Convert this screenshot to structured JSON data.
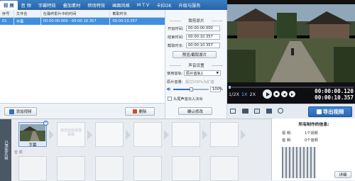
{
  "tabs": [
    "视 频",
    "音 频",
    "字幕特效",
    "叠加素材",
    "转场特效",
    "画面风格",
    "M T V",
    "卡拉OK",
    "升级与服务"
  ],
  "table": {
    "headers": [
      "序号",
      "文件名",
      "在最终影片中的时间",
      "截取时长"
    ],
    "rows": [
      {
        "num": "01",
        "name": "字幕",
        "time": "00:00:00.000 - 00:00:10.357",
        "duration": "00:00:10.357"
      }
    ]
  },
  "clipbar": {
    "add_label": "添加视频",
    "delete_label": "删除"
  },
  "settings": {
    "section_clip": "裁剪原片",
    "start_label": "开始时间:",
    "start_value": "00:00:00.000",
    "end_label": "结束时间:",
    "end_value": "00:00:10.357",
    "duration_label": "截取时长:",
    "duration_value": "00:00:10.357",
    "preview_button": "预览/截取原片",
    "section_audio": "声音设置",
    "track_label": "使用音轨:",
    "track_value": "原片音轨1",
    "volume_label": "原片音量:",
    "volume_hint": "超过100%为扩音",
    "volume_value": "100%",
    "fade_label": "头尾声音淡入淡出",
    "confirm_button": "确认修改"
  },
  "player": {
    "speed_options": [
      "1/2X",
      "1X",
      "2X"
    ],
    "current_time": "00:00:00.120",
    "total_time": "00:00:10.357",
    "export_label": "导出视频"
  },
  "timeline": {
    "side_label": "已添加片段",
    "clip_label": "字幕",
    "hint": "双击此处添加视频",
    "audio_label": "音 频"
  },
  "info": {
    "title": "所有制作的信息:",
    "video_label": "视 频:",
    "video_value": "1个视频",
    "audio_label": "音 频:",
    "audio_value": "0个音频",
    "detail_button": "详细"
  },
  "colors": {
    "accent": "#3f8fe0",
    "tabbar": "#2a62a3",
    "export": "#2f74c8"
  }
}
